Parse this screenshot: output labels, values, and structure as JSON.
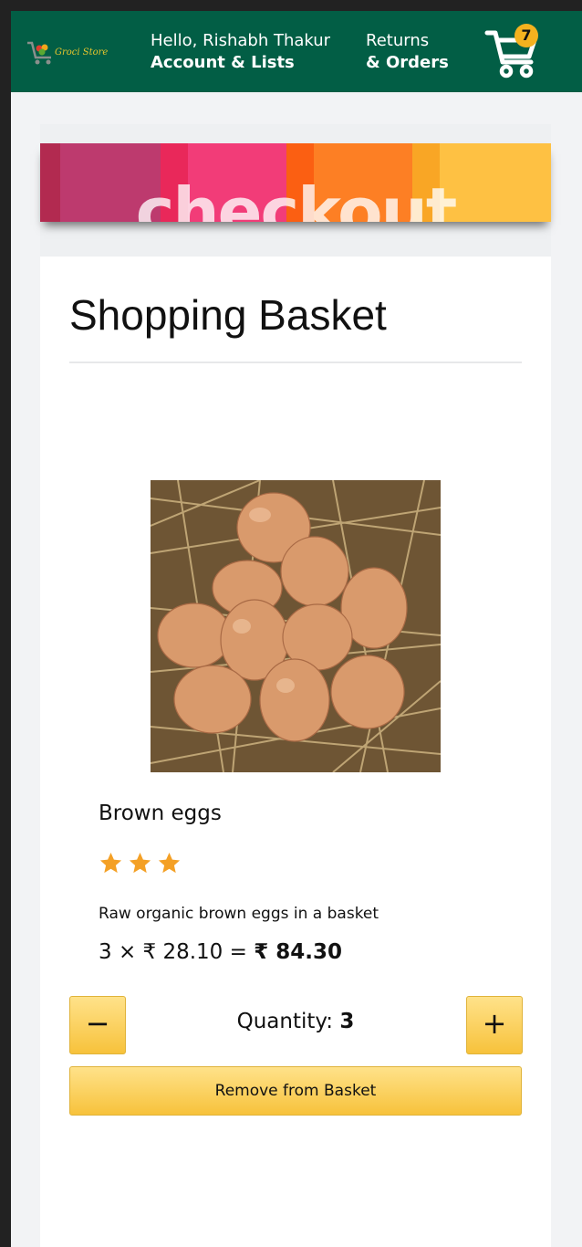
{
  "header": {
    "logo_text": "Groci Store",
    "greeting": "Hello, Rishabh Thakur",
    "account_label": "Account & Lists",
    "returns_label": "Returns",
    "orders_label": "& Orders",
    "cart_count": "7"
  },
  "banner": {
    "text": "checkout"
  },
  "basket": {
    "title": "Shopping Basket",
    "item": {
      "name": "Brown eggs",
      "rating": 3,
      "description": "Raw organic brown eggs in a basket",
      "quantity_multiplier": "3 ×",
      "unit_price": "₹ 28.10",
      "equals": "=",
      "total_price": "₹ 84.30",
      "quantity_prefix": "Quantity:",
      "quantity_value": "3"
    },
    "decrease_label": "−",
    "increase_label": "+",
    "remove_label": "Remove from Basket"
  },
  "colors": {
    "header_bg": "#025e45",
    "button_yellow": "#f7c23b",
    "star": "#f4a025",
    "badge": "#f4b21f"
  }
}
